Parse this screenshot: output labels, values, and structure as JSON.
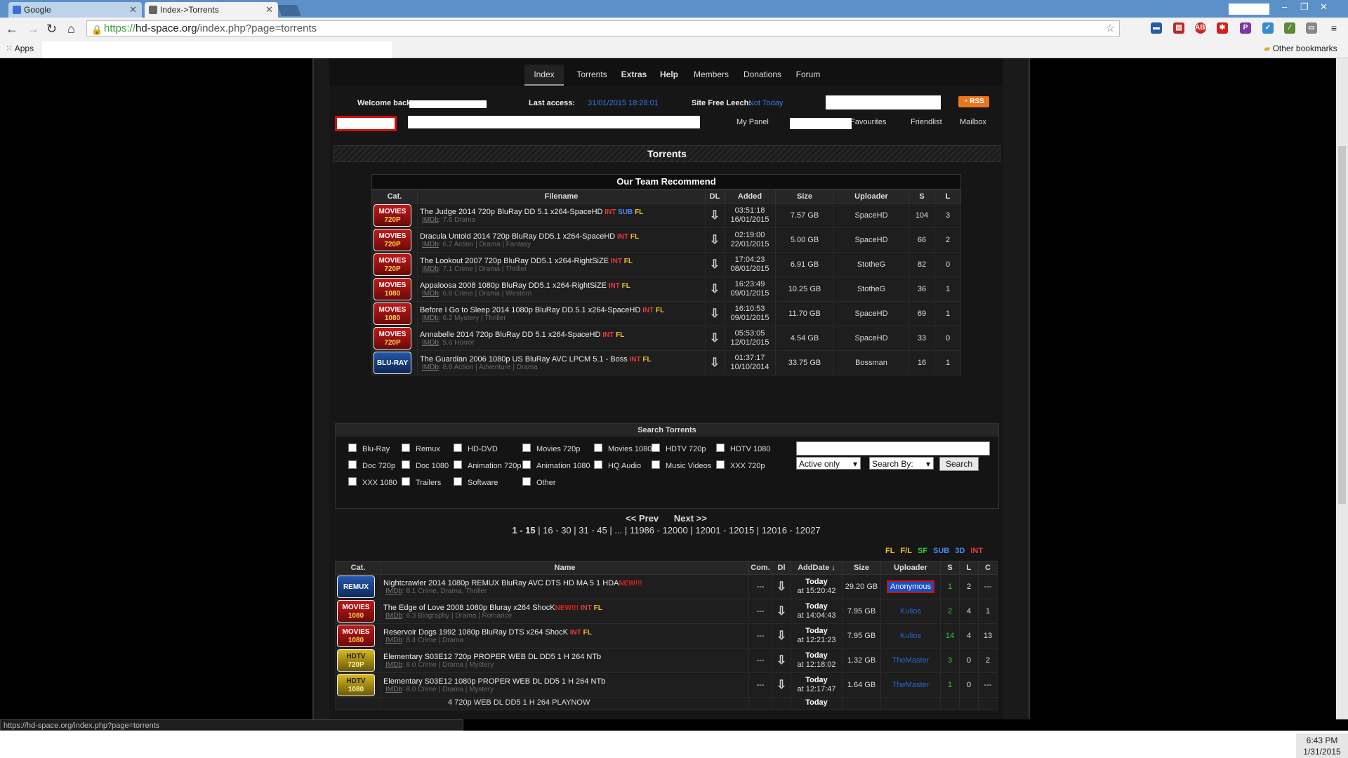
{
  "browser": {
    "tabs": [
      {
        "title": "Google",
        "active": false
      },
      {
        "title": "Index->Torrents",
        "active": true
      }
    ],
    "url_prefix": "https://",
    "url_host": "hd-space.org",
    "url_path": "/index.php?page=torrents",
    "bookmarks_apps": "Apps",
    "bookmarks_other": "Other bookmarks",
    "status_url": "https://hd-space.org/index.php?page=torrents"
  },
  "nav": {
    "items": [
      "Index",
      "Torrents",
      "Extras",
      "Help",
      "Members",
      "Donations",
      "Forum"
    ]
  },
  "welcome": {
    "welcome_label": "Welcome back",
    "last_access_label": "Last access:",
    "last_access_value": "31/01/2015 18:28:01",
    "free_leech_label": "Site Free Leech:",
    "free_leech_value": "Not Today",
    "rss": "RSS"
  },
  "panel": {
    "my_panel": "My Panel",
    "favourites": "Favourites",
    "friendlist": "Friendlist",
    "mailbox": "Mailbox"
  },
  "torrents_header": "Torrents",
  "recommend": {
    "title": "Our Team Recommend",
    "columns": [
      "Cat.",
      "Filename",
      "DL",
      "Added",
      "Size",
      "Uploader",
      "S",
      "L"
    ],
    "rows": [
      {
        "cat_top": "MOVIES",
        "cat_sub": "720P",
        "name": "The Judge 2014 720p BluRay DD 5.1 x264-SpaceHD",
        "tags": [
          "INT",
          "SUB",
          "FL"
        ],
        "imdb_label": "IMDb",
        "rating": "7.6",
        "genres": "Drama",
        "time": "03:51:18",
        "date": "16/01/2015",
        "size": "7.57 GB",
        "uploader": "SpaceHD",
        "s": "104",
        "l": "3"
      },
      {
        "cat_top": "MOVIES",
        "cat_sub": "720P",
        "name": "Dracula Untold 2014 720p BluRay DD5.1 x264-SpaceHD",
        "tags": [
          "INT",
          "FL"
        ],
        "imdb_label": "IMDb",
        "rating": "6.2",
        "genres": "Action | Drama | Fantasy",
        "time": "02:19:00",
        "date": "22/01/2015",
        "size": "5.00 GB",
        "uploader": "SpaceHD",
        "s": "66",
        "l": "2"
      },
      {
        "cat_top": "MOVIES",
        "cat_sub": "720P",
        "name": "The Lookout 2007 720p BluRay DD5.1 x264-RightSiZE",
        "tags": [
          "INT",
          "FL"
        ],
        "imdb_label": "IMDb",
        "rating": "7.1",
        "genres": "Crime | Drama | Thriller",
        "time": "17:04:23",
        "date": "08/01/2015",
        "size": "6.91 GB",
        "uploader": "StotheG",
        "s": "82",
        "l": "0"
      },
      {
        "cat_top": "MOVIES",
        "cat_sub": "1080",
        "name": "Appaloosa 2008 1080p BluRay DD5.1 x264-RightSiZE",
        "tags": [
          "INT",
          "FL"
        ],
        "imdb_label": "IMDb",
        "rating": "6.8",
        "genres": "Crime | Drama | Western",
        "time": "16:23:49",
        "date": "09/01/2015",
        "size": "10.25 GB",
        "uploader": "StotheG",
        "s": "36",
        "l": "1"
      },
      {
        "cat_top": "MOVIES",
        "cat_sub": "1080",
        "name": "Before I Go to Sleep 2014 1080p BluRay DD.5.1 x264-SpaceHD",
        "tags": [
          "INT",
          "FL"
        ],
        "imdb_label": "IMDb",
        "rating": "6.2",
        "genres": "Mystery | Thriller",
        "time": "16:10:53",
        "date": "09/01/2015",
        "size": "11.70 GB",
        "uploader": "SpaceHD",
        "s": "69",
        "l": "1"
      },
      {
        "cat_top": "MOVIES",
        "cat_sub": "720P",
        "name": "Annabelle 2014 720p BluRay DD 5.1 x264-SpaceHD",
        "tags": [
          "INT",
          "FL"
        ],
        "imdb_label": "IMDb",
        "rating": "5.6",
        "genres": "Horror",
        "time": "05:53:05",
        "date": "12/01/2015",
        "size": "4.54 GB",
        "uploader": "SpaceHD",
        "s": "33",
        "l": "0"
      },
      {
        "cat_top": "BLU-RAY",
        "cat_sub": "",
        "name": "The Guardian 2006 1080p US BluRay AVC LPCM 5.1 - Boss",
        "tags": [
          "INT",
          "FL"
        ],
        "imdb_label": "IMDb",
        "rating": "6.8",
        "genres": "Action | Adventure | Drama",
        "time": "01:37:17",
        "date": "10/10/2014",
        "size": "33.75 GB",
        "uploader": "Bossman",
        "s": "16",
        "l": "1"
      }
    ]
  },
  "search": {
    "title": "Search Torrents",
    "categories": [
      [
        "Blu-Ray",
        "Remux",
        "HD-DVD",
        "Movies 720p",
        "Movies 1080",
        "HDTV 720p",
        "HDTV 1080"
      ],
      [
        "Doc 720p",
        "Doc 1080",
        "Animation 720p",
        "Animation 1080",
        "HQ Audio",
        "Music Videos",
        "XXX 720p"
      ],
      [
        "XXX 1080",
        "Trailers",
        "Software",
        "Other"
      ]
    ],
    "filter_value": "Active only",
    "search_by_value": "Search By:",
    "button": "Search"
  },
  "pager": {
    "prev": "<< Prev",
    "next": "Next >>",
    "current": "1 - 15",
    "pages": [
      "16 - 30",
      "31 - 45",
      "...",
      "11986 - 12000",
      "12001 - 12015",
      "12016 - 12027"
    ]
  },
  "flag_legend": [
    {
      "text": "FL",
      "color": "#f0c030"
    },
    {
      "text": "F/L",
      "color": "#f0c030"
    },
    {
      "text": "SF",
      "color": "#3ac83a"
    },
    {
      "text": "SUB",
      "color": "#4a88f0"
    },
    {
      "text": "3D",
      "color": "#4a88f0"
    },
    {
      "text": "INT",
      "color": "#e83a3a"
    }
  ],
  "main": {
    "columns": [
      "Cat.",
      "Name",
      "Com.",
      "Dl",
      "AddDate ↓",
      "Size",
      "Uploader",
      "S",
      "L",
      "C"
    ],
    "rows": [
      {
        "badge": "remux",
        "cat_top": "REMUX",
        "cat_sub": "",
        "name": "Nightcrawler 2014 1080p REMUX BluRay AVC DTS HD MA 5 1 HDA",
        "new": "NEW!!!",
        "tags": [],
        "imdb_label": "IMDb",
        "rating": "8.1",
        "genres": "Crime, Drama, Thriller",
        "com": "---",
        "day": "Today",
        "at": "at 15:20:42",
        "size": "29.20 GB",
        "uploader": "Anonymous",
        "uploader_style": "anon",
        "s": "1",
        "l": "2",
        "c": "---"
      },
      {
        "badge": "movies",
        "cat_top": "MOVIES",
        "cat_sub": "1080",
        "name": "The Edge of Love 2008 1080p Bluray x264 ShocK",
        "new": "NEW!!!",
        "tags": [
          "INT",
          "FL"
        ],
        "imdb_label": "IMDb",
        "rating": "6.3",
        "genres": "Biography | Drama | Romance",
        "com": "---",
        "day": "Today",
        "at": "at 14:04:43",
        "size": "7.95 GB",
        "uploader": "Kulios",
        "uploader_style": "blue",
        "s": "2",
        "l": "4",
        "c": "1"
      },
      {
        "badge": "movies",
        "cat_top": "MOVIES",
        "cat_sub": "1080",
        "name": "Reservoir Dogs 1992 1080p BluRay DTS x264 ShocK",
        "new": "",
        "tags": [
          "INT",
          "FL"
        ],
        "imdb_label": "IMDb",
        "rating": "8.4",
        "genres": "Crime | Drama",
        "com": "---",
        "day": "Today",
        "at": "at 12:21:23",
        "size": "7.95 GB",
        "uploader": "Kulios",
        "uploader_style": "blue",
        "s": "14",
        "l": "4",
        "c": "13"
      },
      {
        "badge": "hdtv",
        "cat_top": "HDTV",
        "cat_sub": "720P",
        "name": "Elementary S03E12 720p PROPER WEB DL DD5 1 H 264 NTb",
        "new": "",
        "tags": [],
        "imdb_label": "IMDb",
        "rating": "8.0",
        "genres": "Crime | Drama | Mystery",
        "com": "---",
        "day": "Today",
        "at": "at 12:18:02",
        "size": "1.32 GB",
        "uploader": "TheMaster",
        "uploader_style": "blue",
        "s": "3",
        "l": "0",
        "c": "2"
      },
      {
        "badge": "hdtv",
        "cat_top": "HDTV",
        "cat_sub": "1080",
        "name": "Elementary S03E12 1080p PROPER WEB DL DD5 1 H 264 NTb",
        "new": "",
        "tags": [],
        "imdb_label": "IMDb",
        "rating": "8.0",
        "genres": "Crime | Drama | Mystery",
        "com": "---",
        "day": "Today",
        "at": "at 12:17:47",
        "size": "1.64 GB",
        "uploader": "TheMaster",
        "uploader_style": "blue",
        "s": "1",
        "l": "0",
        "c": "---"
      }
    ],
    "partial_row_name": "4 720p WEB DL DD5 1 H 264 PLAYNOW",
    "partial_row_day": "Today"
  },
  "taskbar": {
    "time": "6:43 PM",
    "date": "1/31/2015"
  }
}
